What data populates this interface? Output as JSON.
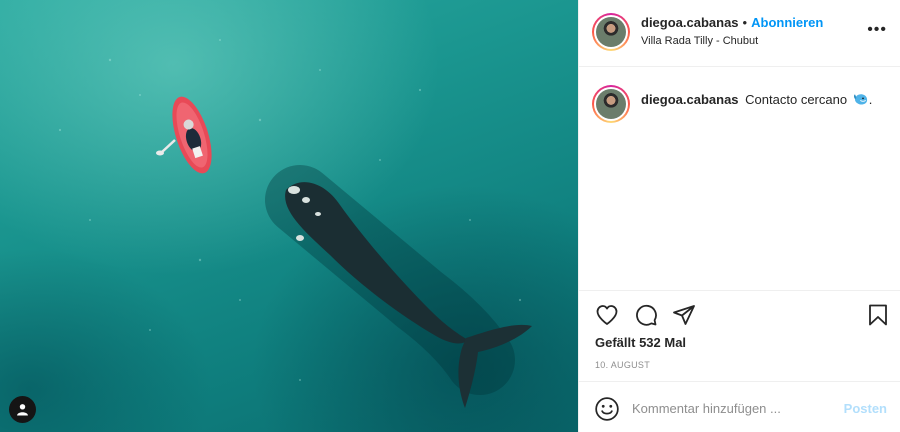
{
  "post": {
    "image_alt": "",
    "user_tag_icon": "person-icon"
  },
  "header": {
    "username": "diegoa.cabanas",
    "separator": "•",
    "follow_label": "Abonnieren",
    "location": "Villa Rada Tilly - Chubut",
    "more_label": "•••"
  },
  "caption": {
    "username": "diegoa.cabanas",
    "text": "Contacto cercano",
    "trailing": ".",
    "emoji_icon": "whale-emoji-icon"
  },
  "actions": {
    "like_icon": "heart-icon",
    "comment_icon": "comment-icon",
    "share_icon": "paper-plane-icon",
    "save_icon": "bookmark-icon",
    "likes_text": "Gefällt 532 Mal",
    "date": "10. AUGUST"
  },
  "add_comment": {
    "placeholder": "Kommentar hinzufügen ...",
    "post_label": "Posten",
    "emoji_icon": "smiley-icon"
  },
  "colors": {
    "accent": "#0095f6",
    "post_disabled": "#b2dffc",
    "border": "#efefef",
    "secondary_text": "#8e8e8e"
  }
}
